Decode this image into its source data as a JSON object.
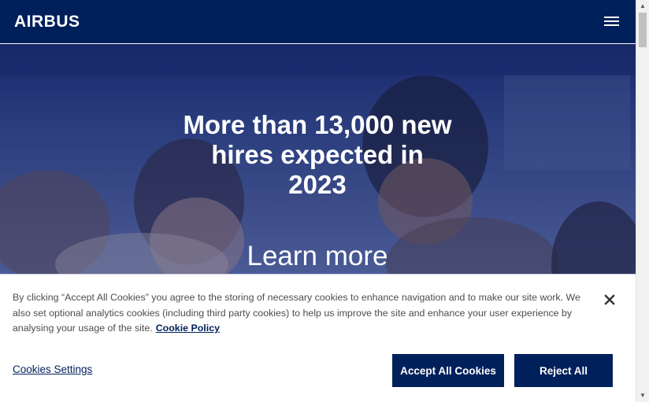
{
  "header": {
    "logo_text": "AIRBUS",
    "menu_icon": "hamburger-menu-icon"
  },
  "hero": {
    "title": "More than 13,000 new hires expected in 2023",
    "link_label": "Learn more"
  },
  "cookie_banner": {
    "text": "By clicking “Accept All Cookies” you agree to the storing of necessary cookies to enhance navigation and to make our site work. We also set optional analytics cookies (including third party cookies) to help us improve the site and enhance your user experience by analysing your usage of the site.",
    "policy_link": "Cookie Policy",
    "settings_label": "Cookies Settings",
    "accept_label": "Accept All Cookies",
    "reject_label": "Reject All",
    "close_icon": "close-icon"
  },
  "colors": {
    "brand_navy": "#00205b",
    "text_gray": "#4d4d4d",
    "white": "#ffffff"
  }
}
